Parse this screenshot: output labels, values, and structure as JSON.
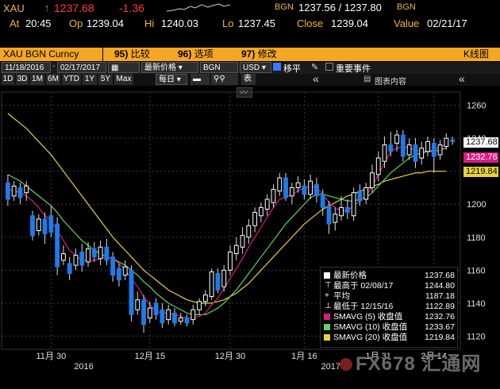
{
  "quote": {
    "ticker": "XAU",
    "last_arrow": "↑",
    "last": "1237.68",
    "change": "-1.36",
    "bid_source": "BGN",
    "bid_ask": "1237.56 / 1237.80",
    "ask_source": "BGN",
    "at_label": "At",
    "time": "20:45",
    "open_label": "Op",
    "open": "1239.04",
    "high_label": "Hi",
    "high": "1240.03",
    "low_label": "Lo",
    "low": "1237.45",
    "close_label": "Close",
    "close": "1239.04",
    "value_label": "Value",
    "value_date": "02/21/17"
  },
  "tabs": {
    "security": "XAU BGN Curncy",
    "compare_num": "95)",
    "compare": "比较",
    "options_num": "96)",
    "options": "选项",
    "edit_num": "97)",
    "edit": "修改",
    "right": "K线图"
  },
  "toolbar": {
    "start_date": "11/18/2016",
    "end_date": "02/17/2017",
    "field": "最新价格",
    "source": "BGN",
    "currency": "USD",
    "moving_avg": "移平",
    "events": "重要事件",
    "ranges": [
      "1D",
      "3D",
      "1M",
      "6M",
      "YTD",
      "1Y",
      "5Y",
      "Max"
    ],
    "interval": "每日",
    "table_label": "表",
    "collapse": "«",
    "table_content": "图表内容"
  },
  "chart_data": {
    "type": "candlestick",
    "y_ticks": [
      "1260",
      "1240",
      "1220",
      "1200",
      "1180",
      "1160",
      "1140",
      "1120"
    ],
    "ylim": [
      1112,
      1268
    ],
    "x_ticks": [
      "11月 30",
      "12月 15",
      "12月 30",
      "1月 16",
      "1月 31",
      "2月 14"
    ],
    "year_labels": [
      "2016",
      "2017"
    ],
    "last_price_tag": "1237.68",
    "ma5_tag": "1232.76",
    "ma20_tag": "1219.84",
    "colors": {
      "up": "#ffffff",
      "down": "#1f7be8",
      "ma5": "#d81b86",
      "ma10": "#5fd35f",
      "ma20": "#e6d23c"
    },
    "candles": [
      {
        "o": 1213,
        "c": 1203,
        "h": 1218,
        "l": 1199
      },
      {
        "o": 1205,
        "c": 1211,
        "h": 1214,
        "l": 1202
      },
      {
        "o": 1210,
        "c": 1204,
        "h": 1213,
        "l": 1200
      },
      {
        "o": 1207,
        "c": 1211,
        "h": 1214,
        "l": 1202
      },
      {
        "o": 1193,
        "c": 1181,
        "h": 1196,
        "l": 1178
      },
      {
        "o": 1184,
        "c": 1191,
        "h": 1194,
        "l": 1181
      },
      {
        "o": 1191,
        "c": 1182,
        "h": 1195,
        "l": 1176
      },
      {
        "o": 1193,
        "c": 1183,
        "h": 1199,
        "l": 1180
      },
      {
        "o": 1188,
        "c": 1162,
        "h": 1192,
        "l": 1157
      },
      {
        "o": 1166,
        "c": 1170,
        "h": 1175,
        "l": 1163
      },
      {
        "o": 1164,
        "c": 1158,
        "h": 1168,
        "l": 1154
      },
      {
        "o": 1163,
        "c": 1169,
        "h": 1173,
        "l": 1160
      },
      {
        "o": 1171,
        "c": 1163,
        "h": 1176,
        "l": 1159
      },
      {
        "o": 1165,
        "c": 1173,
        "h": 1177,
        "l": 1162
      },
      {
        "o": 1173,
        "c": 1168,
        "h": 1177,
        "l": 1165
      },
      {
        "o": 1167,
        "c": 1174,
        "h": 1178,
        "l": 1163
      },
      {
        "o": 1174,
        "c": 1166,
        "h": 1179,
        "l": 1163
      },
      {
        "o": 1168,
        "c": 1157,
        "h": 1171,
        "l": 1153
      },
      {
        "o": 1161,
        "c": 1154,
        "h": 1164,
        "l": 1150
      },
      {
        "o": 1157,
        "c": 1162,
        "h": 1166,
        "l": 1154
      },
      {
        "o": 1160,
        "c": 1133,
        "h": 1163,
        "l": 1129
      },
      {
        "o": 1136,
        "c": 1142,
        "h": 1147,
        "l": 1133
      },
      {
        "o": 1142,
        "c": 1127,
        "h": 1145,
        "l": 1122
      },
      {
        "o": 1131,
        "c": 1137,
        "h": 1141,
        "l": 1128
      },
      {
        "o": 1140,
        "c": 1133,
        "h": 1143,
        "l": 1130
      },
      {
        "o": 1136,
        "c": 1128,
        "h": 1140,
        "l": 1125
      },
      {
        "o": 1130,
        "c": 1136,
        "h": 1139,
        "l": 1127
      },
      {
        "o": 1134,
        "c": 1128,
        "h": 1137,
        "l": 1126
      },
      {
        "o": 1129,
        "c": 1131,
        "h": 1134,
        "l": 1127
      },
      {
        "o": 1131,
        "c": 1128,
        "h": 1133,
        "l": 1126
      },
      {
        "o": 1130,
        "c": 1136,
        "h": 1139,
        "l": 1127
      },
      {
        "o": 1136,
        "c": 1141,
        "h": 1143,
        "l": 1133
      },
      {
        "o": 1141,
        "c": 1145,
        "h": 1148,
        "l": 1138
      },
      {
        "o": 1144,
        "c": 1159,
        "h": 1161,
        "l": 1142
      },
      {
        "o": 1158,
        "c": 1148,
        "h": 1161,
        "l": 1146
      },
      {
        "o": 1150,
        "c": 1160,
        "h": 1163,
        "l": 1147
      },
      {
        "o": 1160,
        "c": 1171,
        "h": 1175,
        "l": 1157
      },
      {
        "o": 1170,
        "c": 1175,
        "h": 1180,
        "l": 1166
      },
      {
        "o": 1174,
        "c": 1181,
        "h": 1186,
        "l": 1170
      },
      {
        "o": 1180,
        "c": 1187,
        "h": 1191,
        "l": 1176
      },
      {
        "o": 1187,
        "c": 1195,
        "h": 1198,
        "l": 1183
      },
      {
        "o": 1193,
        "c": 1198,
        "h": 1201,
        "l": 1189
      },
      {
        "o": 1197,
        "c": 1203,
        "h": 1206,
        "l": 1193
      },
      {
        "o": 1201,
        "c": 1209,
        "h": 1212,
        "l": 1198
      },
      {
        "o": 1208,
        "c": 1216,
        "h": 1219,
        "l": 1205
      },
      {
        "o": 1216,
        "c": 1204,
        "h": 1219,
        "l": 1202
      },
      {
        "o": 1205,
        "c": 1210,
        "h": 1213,
        "l": 1200
      },
      {
        "o": 1210,
        "c": 1213,
        "h": 1217,
        "l": 1207
      },
      {
        "o": 1211,
        "c": 1206,
        "h": 1215,
        "l": 1203
      },
      {
        "o": 1206,
        "c": 1214,
        "h": 1218,
        "l": 1203
      },
      {
        "o": 1212,
        "c": 1205,
        "h": 1216,
        "l": 1201
      },
      {
        "o": 1206,
        "c": 1198,
        "h": 1209,
        "l": 1193
      },
      {
        "o": 1199,
        "c": 1188,
        "h": 1202,
        "l": 1182
      },
      {
        "o": 1189,
        "c": 1194,
        "h": 1198,
        "l": 1184
      },
      {
        "o": 1193,
        "c": 1198,
        "h": 1205,
        "l": 1190
      },
      {
        "o": 1198,
        "c": 1195,
        "h": 1203,
        "l": 1191
      },
      {
        "o": 1193,
        "c": 1207,
        "h": 1210,
        "l": 1190
      },
      {
        "o": 1208,
        "c": 1202,
        "h": 1212,
        "l": 1199
      },
      {
        "o": 1203,
        "c": 1210,
        "h": 1213,
        "l": 1200
      },
      {
        "o": 1210,
        "c": 1219,
        "h": 1224,
        "l": 1207
      },
      {
        "o": 1218,
        "c": 1228,
        "h": 1232,
        "l": 1214
      },
      {
        "o": 1226,
        "c": 1236,
        "h": 1241,
        "l": 1222
      },
      {
        "o": 1236,
        "c": 1232,
        "h": 1244,
        "l": 1229
      },
      {
        "o": 1237,
        "c": 1242,
        "h": 1245,
        "l": 1232
      },
      {
        "o": 1242,
        "c": 1229,
        "h": 1245,
        "l": 1226
      },
      {
        "o": 1230,
        "c": 1236,
        "h": 1240,
        "l": 1227
      },
      {
        "o": 1236,
        "c": 1226,
        "h": 1240,
        "l": 1222
      },
      {
        "o": 1228,
        "c": 1234,
        "h": 1238,
        "l": 1224
      },
      {
        "o": 1232,
        "c": 1238,
        "h": 1241,
        "l": 1229
      },
      {
        "o": 1237,
        "c": 1229,
        "h": 1240,
        "l": 1219
      },
      {
        "o": 1230,
        "c": 1236,
        "h": 1239,
        "l": 1227
      },
      {
        "o": 1235,
        "c": 1240,
        "h": 1243,
        "l": 1233
      },
      {
        "o": 1239,
        "c": 1238,
        "h": 1241,
        "l": 1236
      }
    ],
    "ma5": [
      1209,
      1208,
      1207,
      1205,
      1202,
      1198,
      1193,
      1190,
      1184,
      1178,
      1172,
      1169,
      1166,
      1166,
      1166,
      1167,
      1168,
      1167,
      1164,
      1160,
      1155,
      1150,
      1144,
      1139,
      1135,
      1134,
      1134,
      1133,
      1132,
      1131,
      1131,
      1132,
      1134,
      1139,
      1143,
      1149,
      1155,
      1161,
      1167,
      1174,
      1180,
      1186,
      1192,
      1198,
      1203,
      1204,
      1206,
      1208,
      1210,
      1211,
      1210,
      1206,
      1201,
      1198,
      1196,
      1196,
      1199,
      1202,
      1205,
      1211,
      1218,
      1225,
      1232,
      1234,
      1235,
      1234,
      1233,
      1232,
      1232,
      1233,
      1235,
      1236
    ],
    "ma10": [
      1218,
      1216,
      1214,
      1211,
      1208,
      1205,
      1202,
      1199,
      1195,
      1190,
      1186,
      1182,
      1178,
      1175,
      1172,
      1170,
      1168,
      1167,
      1165,
      1163,
      1160,
      1157,
      1153,
      1150,
      1146,
      1143,
      1140,
      1138,
      1136,
      1134,
      1133,
      1133,
      1133,
      1135,
      1137,
      1140,
      1144,
      1148,
      1153,
      1158,
      1163,
      1168,
      1173,
      1178,
      1183,
      1188,
      1192,
      1196,
      1200,
      1204,
      1206,
      1206,
      1205,
      1204,
      1203,
      1202,
      1202,
      1203,
      1204,
      1207,
      1211,
      1215,
      1219,
      1222,
      1225,
      1228,
      1230,
      1231,
      1232,
      1232,
      1233,
      1234
    ],
    "ma20": [
      1255,
      1252,
      1249,
      1246,
      1242,
      1238,
      1234,
      1230,
      1225,
      1220,
      1215,
      1210,
      1205,
      1200,
      1195,
      1190,
      1185,
      1180,
      1176,
      1172,
      1168,
      1164,
      1160,
      1157,
      1154,
      1151,
      1148,
      1146,
      1144,
      1142,
      1141,
      1140,
      1140,
      1140,
      1141,
      1142,
      1144,
      1146,
      1149,
      1152,
      1156,
      1160,
      1164,
      1168,
      1172,
      1176,
      1180,
      1184,
      1188,
      1191,
      1194,
      1197,
      1199,
      1201,
      1203,
      1205,
      1206,
      1208,
      1209,
      1211,
      1212,
      1214,
      1215,
      1216,
      1217,
      1218,
      1219,
      1219,
      1220,
      1220,
      1220,
      1220
    ]
  },
  "legend": {
    "rows": [
      {
        "name": "最新价格",
        "value": "1237.68",
        "color": "#ffffff",
        "marker": "box"
      },
      {
        "name": "最高于 02/08/17",
        "value": "1244.80",
        "color": "#ffffff",
        "marker": "up"
      },
      {
        "name": "平均",
        "value": "1187.18",
        "color": "#ffffff",
        "marker": "avg"
      },
      {
        "name": "最低于 12/15/16",
        "value": "1122.89",
        "color": "#ffffff",
        "marker": "down"
      },
      {
        "name": "SMAVG (5) 收盘值",
        "value": "1232.76",
        "color": "#d81b86",
        "marker": "box"
      },
      {
        "name": "SMAVG (10) 收盘值",
        "value": "1233.67",
        "color": "#5fd35f",
        "marker": "box"
      },
      {
        "name": "SMAVG (20) 收盘值",
        "value": "1219.84",
        "color": "#e6d23c",
        "marker": "box"
      }
    ]
  },
  "watermark": {
    "text": "FX678",
    "suffix": "汇通网"
  }
}
